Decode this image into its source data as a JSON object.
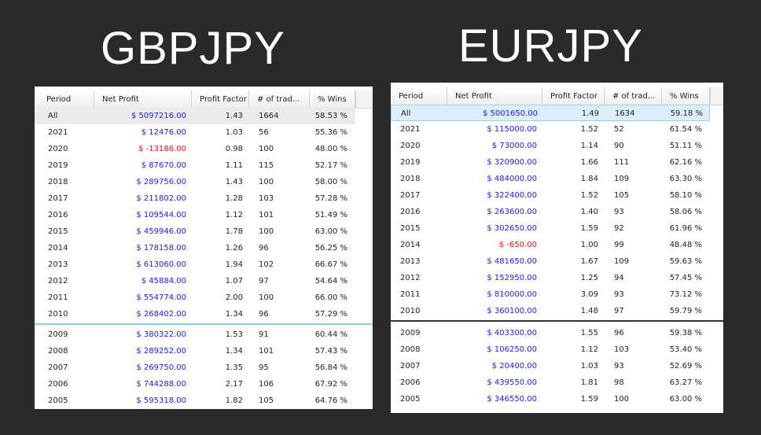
{
  "titles": {
    "left": "GBPJPY",
    "right": "EURJPY"
  },
  "columns": [
    "Period",
    "Net Profit",
    "Profit Factor",
    "# of trad...",
    "% Wins"
  ],
  "gbpjpy": {
    "top_rows": [
      {
        "period": "All",
        "net": "$ 5097216.00",
        "pf": "1.43",
        "trades": "1664",
        "wins": "58.53 %",
        "neg": false
      },
      {
        "period": "2021",
        "net": "$ 12476.00",
        "pf": "1.03",
        "trades": "56",
        "wins": "55.36 %",
        "neg": false
      },
      {
        "period": "2020",
        "net": "$ -13186.00",
        "pf": "0.98",
        "trades": "100",
        "wins": "48.00 %",
        "neg": true
      },
      {
        "period": "2019",
        "net": "$ 87670.00",
        "pf": "1.11",
        "trades": "115",
        "wins": "52.17 %",
        "neg": false
      },
      {
        "period": "2018",
        "net": "$ 289756.00",
        "pf": "1.43",
        "trades": "100",
        "wins": "58.00 %",
        "neg": false
      },
      {
        "period": "2017",
        "net": "$ 211802.00",
        "pf": "1.28",
        "trades": "103",
        "wins": "57.28 %",
        "neg": false
      },
      {
        "period": "2016",
        "net": "$ 109544.00",
        "pf": "1.12",
        "trades": "101",
        "wins": "51.49 %",
        "neg": false
      },
      {
        "period": "2015",
        "net": "$ 459946.00",
        "pf": "1.78",
        "trades": "100",
        "wins": "63.00 %",
        "neg": false
      },
      {
        "period": "2014",
        "net": "$ 178158.00",
        "pf": "1.26",
        "trades": "96",
        "wins": "56.25 %",
        "neg": false
      },
      {
        "period": "2013",
        "net": "$ 613060.00",
        "pf": "1.94",
        "trades": "102",
        "wins": "66.67 %",
        "neg": false
      },
      {
        "period": "2012",
        "net": "$ 45884.00",
        "pf": "1.07",
        "trades": "97",
        "wins": "54.64 %",
        "neg": false
      },
      {
        "period": "2011",
        "net": "$ 554774.00",
        "pf": "2.00",
        "trades": "100",
        "wins": "66.00 %",
        "neg": false
      },
      {
        "period": "2010",
        "net": "$ 268402.00",
        "pf": "1.34",
        "trades": "96",
        "wins": "57.29 %",
        "neg": false
      }
    ],
    "bottom_rows": [
      {
        "period": "2009",
        "net": "$ 380322.00",
        "pf": "1.53",
        "trades": "91",
        "wins": "60.44 %",
        "neg": false
      },
      {
        "period": "2008",
        "net": "$ 289252.00",
        "pf": "1.34",
        "trades": "101",
        "wins": "57.43 %",
        "neg": false
      },
      {
        "period": "2007",
        "net": "$ 269750.00",
        "pf": "1.35",
        "trades": "95",
        "wins": "56.84 %",
        "neg": false
      },
      {
        "period": "2006",
        "net": "$ 744288.00",
        "pf": "2.17",
        "trades": "106",
        "wins": "67.92 %",
        "neg": false
      },
      {
        "period": "2005",
        "net": "$ 595318.00",
        "pf": "1.82",
        "trades": "105",
        "wins": "64.76 %",
        "neg": false
      }
    ]
  },
  "eurjpy": {
    "top_rows": [
      {
        "period": "All",
        "net": "$ 5001650.00",
        "pf": "1.49",
        "trades": "1634",
        "wins": "59.18 %",
        "neg": false
      },
      {
        "period": "2021",
        "net": "$ 115000.00",
        "pf": "1.52",
        "trades": "52",
        "wins": "61.54 %",
        "neg": false
      },
      {
        "period": "2020",
        "net": "$ 73000.00",
        "pf": "1.14",
        "trades": "90",
        "wins": "51.11 %",
        "neg": false
      },
      {
        "period": "2019",
        "net": "$ 320900.00",
        "pf": "1.66",
        "trades": "111",
        "wins": "62.16 %",
        "neg": false
      },
      {
        "period": "2018",
        "net": "$ 484000.00",
        "pf": "1.84",
        "trades": "109",
        "wins": "63.30 %",
        "neg": false
      },
      {
        "period": "2017",
        "net": "$ 322400.00",
        "pf": "1.52",
        "trades": "105",
        "wins": "58.10 %",
        "neg": false
      },
      {
        "period": "2016",
        "net": "$ 263600.00",
        "pf": "1.40",
        "trades": "93",
        "wins": "58.06 %",
        "neg": false
      },
      {
        "period": "2015",
        "net": "$ 302650.00",
        "pf": "1.59",
        "trades": "92",
        "wins": "61.96 %",
        "neg": false
      },
      {
        "period": "2014",
        "net": "$ -650.00",
        "pf": "1.00",
        "trades": "99",
        "wins": "48.48 %",
        "neg": true
      },
      {
        "period": "2013",
        "net": "$ 481650.00",
        "pf": "1.67",
        "trades": "109",
        "wins": "59.63 %",
        "neg": false
      },
      {
        "period": "2012",
        "net": "$ 152950.00",
        "pf": "1.25",
        "trades": "94",
        "wins": "57.45 %",
        "neg": false
      },
      {
        "period": "2011",
        "net": "$ 810000.00",
        "pf": "3.09",
        "trades": "93",
        "wins": "73.12 %",
        "neg": false
      },
      {
        "period": "2010",
        "net": "$ 360100.00",
        "pf": "1.48",
        "trades": "97",
        "wins": "59.79 %",
        "neg": false
      }
    ],
    "bottom_rows": [
      {
        "period": "2009",
        "net": "$ 403300.00",
        "pf": "1.55",
        "trades": "96",
        "wins": "59.38 %",
        "neg": false
      },
      {
        "period": "2008",
        "net": "$ 106250.00",
        "pf": "1.12",
        "trades": "103",
        "wins": "53.40 %",
        "neg": false
      },
      {
        "period": "2007",
        "net": "$ 20400.00",
        "pf": "1.03",
        "trades": "93",
        "wins": "52.69 %",
        "neg": false
      },
      {
        "period": "2006",
        "net": "$ 439550.00",
        "pf": "1.81",
        "trades": "98",
        "wins": "63.27 %",
        "neg": false
      },
      {
        "period": "2005",
        "net": "$ 346550.00",
        "pf": "1.59",
        "trades": "100",
        "wins": "63.00 %",
        "neg": false
      }
    ]
  },
  "colors": {
    "background": "#2a2a2a",
    "positive": "#1a1aff",
    "negative": "#ee1111",
    "selected_right": "#dbeefb"
  }
}
